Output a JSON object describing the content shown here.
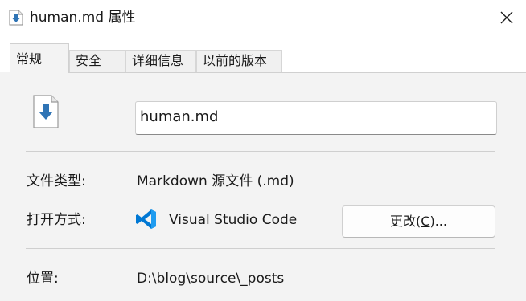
{
  "window": {
    "title": "human.md 属性",
    "title_icon": "markdown-file-icon",
    "close_icon": "close-icon"
  },
  "tabs": [
    {
      "label": "常规",
      "active": true
    },
    {
      "label": "安全",
      "active": false
    },
    {
      "label": "详细信息",
      "active": false
    },
    {
      "label": "以前的版本",
      "active": false
    }
  ],
  "general": {
    "file_icon": "download-file-icon",
    "filename_value": "human.md",
    "file_type_label": "文件类型:",
    "file_type_value": "Markdown 源文件 (.md)",
    "opens_with_label": "打开方式:",
    "opens_with_app_icon": "vscode-icon",
    "opens_with_value": "Visual Studio Code",
    "change_button": {
      "prefix": "更改(",
      "mnemonic": "C",
      "suffix": ")..."
    },
    "location_label": "位置:",
    "location_value": "D:\\blog\\source\\_posts"
  },
  "colors": {
    "accent_blue": "#2f74b5",
    "vscode_blue": "#0078d4"
  }
}
